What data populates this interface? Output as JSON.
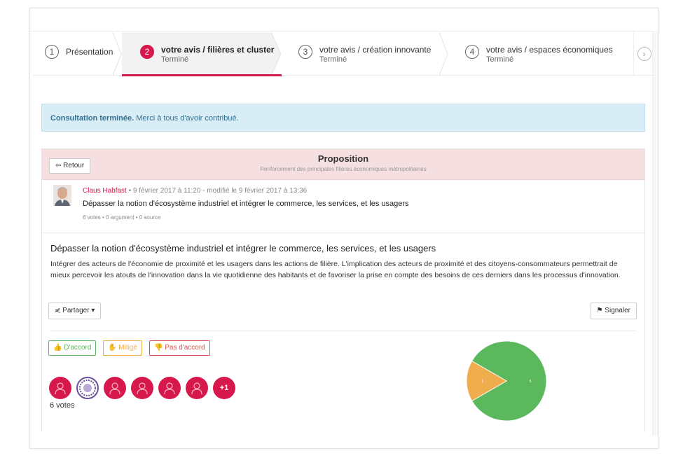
{
  "steps": [
    {
      "number": "1",
      "title": "Présentation",
      "status": ""
    },
    {
      "number": "2",
      "title": "votre avis / filières et cluster",
      "status": "Terminé"
    },
    {
      "number": "3",
      "title": "votre avis / création innovante",
      "status": "Terminé"
    },
    {
      "number": "4",
      "title": "votre avis / espaces économiques",
      "status": "Terminé"
    }
  ],
  "next_icon": "chevron-right-icon",
  "alert": {
    "bold": "Consultation terminée.",
    "text": " Merci à tous d'avoir contribué."
  },
  "card": {
    "back_label": "⇦ Retour",
    "title": "Proposition",
    "subtitle": "Renforcement des principales filières économiques métropolitaines"
  },
  "author": {
    "name": "Claus Habfast",
    "meta": " • 9 février 2017 à 11:20 - modifié le 9 février 2017 à 13:36",
    "proposal_title": "Dépasser la notion d'écosystème industriel et intégrer le commerce, les services, et les usagers",
    "counts": "6 votes • 0 argument • 0 source"
  },
  "content": {
    "heading": "Dépasser la notion d'écosystème industriel et intégrer le commerce, les services, et les usagers",
    "body": "Intégrer des acteurs de l'économie de proximité et les usagers dans les actions de filière. L'implication des acteurs de proximité et des citoyens-consommateurs permettrait de mieux percevoir les atouts de l'innovation dans la vie quotidienne des habitants et de favoriser la prise en compte des besoins de ces derniers dans les processus d'innovation."
  },
  "actions": {
    "share_label": "Partager",
    "report_label": "Signaler"
  },
  "vote_buttons": {
    "agree": "D'accord",
    "mixed": "Mitigé",
    "disagree": "Pas d'accord"
  },
  "voters": {
    "more_label": "+1",
    "count_label": "6 votes"
  },
  "colors": {
    "accent": "#d7184c",
    "agree": "#5cb85c",
    "mixed": "#f0ad4e",
    "disagree": "#d9534f"
  },
  "chart_data": {
    "type": "pie",
    "slices": [
      {
        "label": "D'accord",
        "value": 5,
        "color": "#5cb85c"
      },
      {
        "label": "Mitigé",
        "value": 1,
        "color": "#f0ad4e"
      }
    ]
  }
}
